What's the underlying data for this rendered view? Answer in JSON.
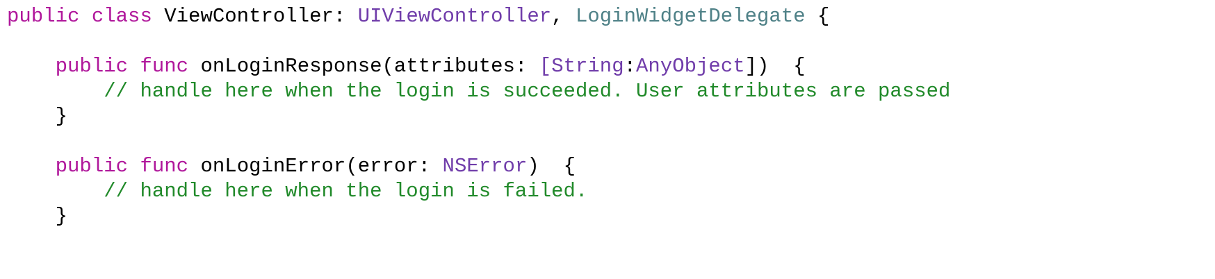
{
  "colors": {
    "keyword": "#b0179b",
    "type": "#703daa",
    "protocol": "#4f8187",
    "comment": "#218a2a",
    "plain": "#000000",
    "background": "#ffffff"
  },
  "code": {
    "l1": {
      "kw1": "public",
      "kw2": "class",
      "name": "ViewController",
      "colon": ":",
      "super": "UIViewController",
      "comma": ",",
      "proto": "LoginWidgetDelegate",
      "brace": "{"
    },
    "l3": {
      "kw1": "public",
      "kw2": "func",
      "fn": "onLoginResponse(attributes:",
      "br_open": "[",
      "t1": "String",
      "sep": ":",
      "t2": "AnyObject",
      "tail": "])",
      "brace": "{"
    },
    "l4": {
      "comment": "// handle here when the login is succeeded. User attributes are passed"
    },
    "l5": {
      "brace": "}"
    },
    "l7": {
      "kw1": "public",
      "kw2": "func",
      "fn": "onLoginError(error:",
      "t1": "NSError",
      "tail": ")",
      "brace": "{"
    },
    "l8": {
      "comment": "// handle here when the login is failed."
    },
    "l9": {
      "brace": "}"
    }
  }
}
